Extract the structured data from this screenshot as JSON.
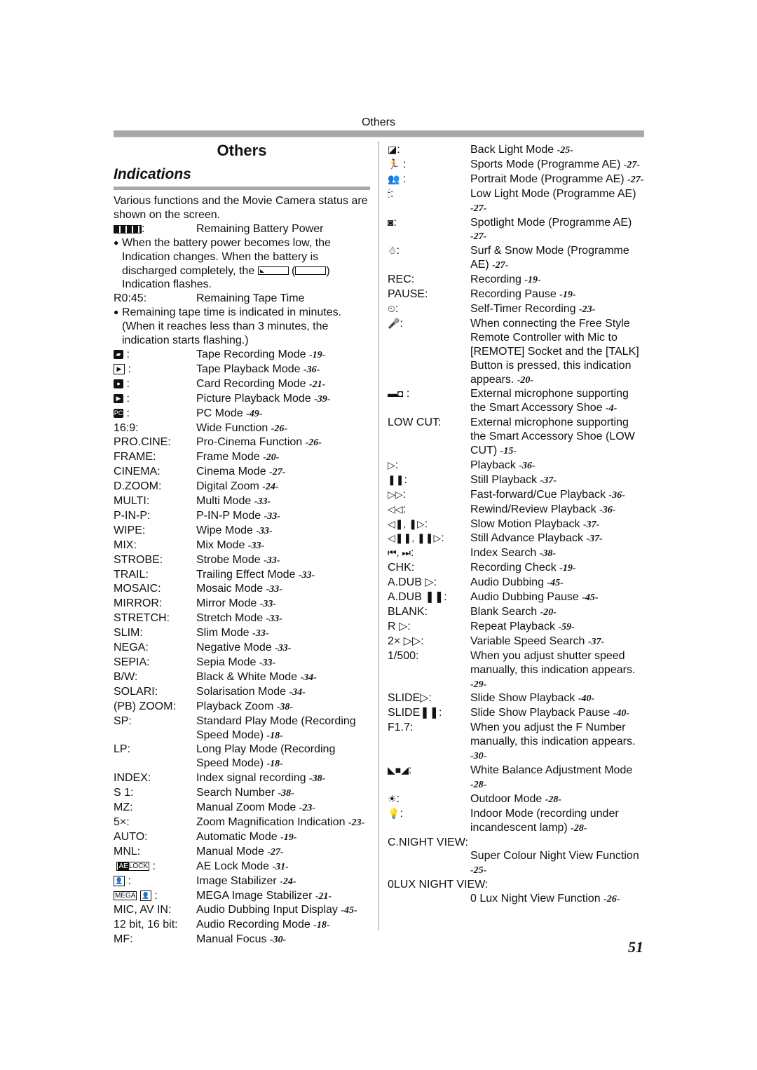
{
  "running_head": "Others",
  "title": "Others",
  "subtitle": "Indications",
  "intro": "Various functions and the Movie Camera status are shown on the screen.",
  "battery": {
    "key_suffix": ":",
    "label": "Remaining Battery Power",
    "note_a": "When the battery power becomes low, the Indication changes. When the battery is discharged completely, the",
    "note_b": "Indication flashes."
  },
  "tape": {
    "key": "R0:45:",
    "label": "Remaining Tape Time",
    "note": "Remaining tape time is indicated in minutes. (When it reaches less than 3 minutes, the indication starts flashing.)"
  },
  "left_icon_rows": [
    {
      "icon": "camera-tape-icon",
      "glyph": "▰",
      "label": "Tape Recording Mode",
      "ref": "-19-"
    },
    {
      "icon": "tape-playback-icon",
      "glyph": "▶",
      "label": "Tape Playback Mode",
      "ref": "-36-"
    },
    {
      "icon": "card-recording-icon",
      "glyph": "●",
      "label": "Card Recording Mode",
      "ref": "-21-"
    },
    {
      "icon": "picture-playback-icon",
      "glyph": "▶",
      "label": "Picture Playback Mode",
      "ref": "-39-"
    },
    {
      "icon": "pc-icon",
      "glyph": "PC",
      "label": "PC Mode",
      "ref": "-49-"
    }
  ],
  "left_rows": [
    {
      "k": "16:9:",
      "v": "Wide Function",
      "ref": "-26-"
    },
    {
      "k": "PRO.CINE:",
      "v": "Pro-Cinema Function",
      "ref": "-26-"
    },
    {
      "k": "FRAME:",
      "v": "Frame Mode",
      "ref": "-20-"
    },
    {
      "k": "CINEMA:",
      "v": "Cinema Mode",
      "ref": "-27-"
    },
    {
      "k": "D.ZOOM:",
      "v": "Digital Zoom",
      "ref": "-24-"
    },
    {
      "k": "MULTI:",
      "v": "Multi Mode",
      "ref": "-33-"
    },
    {
      "k": "P-IN-P:",
      "v": "P-IN-P Mode",
      "ref": "-33-"
    },
    {
      "k": "WIPE:",
      "v": "Wipe Mode",
      "ref": "-33-"
    },
    {
      "k": "MIX:",
      "v": "Mix Mode",
      "ref": "-33-"
    },
    {
      "k": "STROBE:",
      "v": "Strobe Mode",
      "ref": "-33-"
    },
    {
      "k": "TRAIL:",
      "v": "Trailing Effect Mode",
      "ref": "-33-"
    },
    {
      "k": "MOSAIC:",
      "v": "Mosaic Mode",
      "ref": "-33-"
    },
    {
      "k": "MIRROR:",
      "v": "Mirror Mode",
      "ref": "-33-"
    },
    {
      "k": "STRETCH:",
      "v": "Stretch Mode",
      "ref": "-33-"
    },
    {
      "k": "SLIM:",
      "v": "Slim Mode",
      "ref": "-33-"
    },
    {
      "k": "NEGA:",
      "v": "Negative Mode",
      "ref": "-33-"
    },
    {
      "k": "SEPIA:",
      "v": "Sepia Mode",
      "ref": "-33-"
    },
    {
      "k": "B/W:",
      "v": "Black & White Mode",
      "ref": "-34-"
    },
    {
      "k": "SOLARI:",
      "v": "Solarisation Mode",
      "ref": "-34-"
    },
    {
      "k": "(PB) ZOOM:",
      "v": "Playback Zoom",
      "ref": "-38-"
    },
    {
      "k": "SP:",
      "v": "Standard Play Mode (Recording Speed Mode)",
      "ref": "-18-"
    },
    {
      "k": "LP:",
      "v": "Long Play Mode (Recording Speed Mode)",
      "ref": "-18-"
    },
    {
      "k": "INDEX:",
      "v": "Index signal recording",
      "ref": "-38-"
    },
    {
      "k": "S 1:",
      "v": "Search Number",
      "ref": "-38-"
    },
    {
      "k": "MZ:",
      "v": "Manual Zoom Mode",
      "ref": "-23-"
    },
    {
      "k": "5×:",
      "v": "Zoom Magnification Indication",
      "ref": "-23-"
    },
    {
      "k": "AUTO:",
      "v": "Automatic Mode",
      "ref": "-19-"
    },
    {
      "k": "MNL:",
      "v": "Manual Mode",
      "ref": "-27-"
    }
  ],
  "left_rows_2": [
    {
      "icon": "ae-lock-icon",
      "k_a": "AE",
      "k_b": "LOCK",
      "v": "AE Lock Mode",
      "ref": "-31-"
    },
    {
      "icon": "image-stabilizer-icon",
      "v": "Image Stabilizer",
      "ref": "-24-"
    },
    {
      "icon": "mega-stabilizer-icon",
      "k_a": "MEGA",
      "v": "MEGA Image Stabilizer",
      "ref": "-21-"
    },
    {
      "k": "MIC, AV IN:",
      "v": "Audio Dubbing Input Display",
      "ref": "-45-"
    },
    {
      "k": "12 bit, 16 bit:",
      "v": "Audio Recording Mode",
      "ref": "-18-"
    },
    {
      "k": "MF:",
      "v": "Manual Focus",
      "ref": "-30-"
    }
  ],
  "right_rows": [
    {
      "icon": "back-light-icon",
      "glyph": "◪",
      "k": ":",
      "v": "Back Light Mode",
      "ref": "-25-"
    },
    {
      "icon": "sports-icon",
      "glyph": "🏃",
      "k": " :",
      "v": "Sports Mode (Programme AE)",
      "ref": "-27-"
    },
    {
      "icon": "portrait-icon",
      "glyph": "👥",
      "k": " :",
      "v": "Portrait Mode (Programme AE)",
      "ref": "-27-"
    },
    {
      "icon": "low-light-icon",
      "glyph": "🕯",
      "k": ":",
      "v": "Low Light Mode (Programme AE)",
      "ref": "-27-"
    },
    {
      "icon": "spotlight-icon",
      "glyph": "◙",
      "k": ":",
      "v": "Spotlight Mode (Programme AE)",
      "ref": "-27-"
    },
    {
      "icon": "surf-snow-icon",
      "glyph": "☃",
      "k": ":",
      "v": "Surf & Snow Mode (Programme AE)",
      "ref": "-27-"
    },
    {
      "k": "REC:",
      "v": "Recording",
      "ref": "-19-"
    },
    {
      "k": "PAUSE:",
      "v": "Recording Pause",
      "ref": "-19-"
    },
    {
      "icon": "self-timer-icon",
      "glyph": "⏲",
      "k": ":",
      "v": "Self-Timer Recording",
      "ref": "-23-"
    },
    {
      "icon": "talk-mic-icon",
      "glyph": "🎤",
      "k": ":",
      "v": "When connecting the Free Style Remote Controller with Mic to [REMOTE] Socket and the [TALK] Button is pressed, this indication appears.",
      "ref": "-20-"
    },
    {
      "icon": "external-mic-icon",
      "glyph": "▬◘",
      "k": " :",
      "v": "External microphone supporting the Smart Accessory Shoe",
      "ref": "-4-"
    },
    {
      "k": "LOW CUT:",
      "v": "External microphone supporting the Smart Accessory Shoe (LOW CUT)",
      "ref": "-15-"
    },
    {
      "icon": "play-icon",
      "glyph": "▷",
      "k": ":",
      "v": "Playback",
      "ref": "-36-"
    },
    {
      "icon": "pause-icon",
      "glyph": "❚❚",
      "k": ":",
      "v": "Still Playback",
      "ref": "-37-"
    },
    {
      "icon": "fast-forward-icon",
      "glyph": "▷▷",
      "k": ":",
      "v": "Fast-forward/Cue Playback",
      "ref": "-36-"
    },
    {
      "icon": "rewind-icon",
      "glyph": "◁◁",
      "k": ":",
      "v": "Rewind/Review Playback",
      "ref": "-36-"
    },
    {
      "icon": "slow-motion-icon",
      "glyph": "◁❚, ❚▷",
      "k": ":",
      "v": "Slow Motion Playback",
      "ref": "-37-"
    },
    {
      "icon": "still-advance-icon",
      "glyph": "◁❚❚, ❚❚▷",
      "k": ":",
      "v": "Still Advance Playback",
      "ref": "-37-"
    },
    {
      "icon": "index-search-icon",
      "glyph": "⏮, ⏭",
      "k": ":",
      "v": "Index Search",
      "ref": "-38-"
    },
    {
      "k": "CHK:",
      "v": "Recording Check",
      "ref": "-19-"
    },
    {
      "k": "A.DUB ▷:",
      "v": "Audio Dubbing",
      "ref": "-45-"
    },
    {
      "k": "A.DUB ❚❚:",
      "v": "Audio Dubbing Pause",
      "ref": "-45-"
    },
    {
      "k": "BLANK:",
      "v": "Blank Search",
      "ref": "-20-"
    },
    {
      "k": "R ▷:",
      "v": "Repeat Playback",
      "ref": "-59-"
    },
    {
      "k": "2× ▷▷:",
      "v": "Variable Speed Search",
      "ref": "-37-"
    },
    {
      "k": "1/500:",
      "v": "When you adjust shutter speed manually, this indication appears.",
      "ref": "-29-"
    },
    {
      "k": "SLIDE▷:",
      "v": "Slide Show Playback",
      "ref": "-40-"
    },
    {
      "k": "SLIDE❚❚:",
      "v": "Slide Show Playback Pause",
      "ref": "-40-"
    },
    {
      "k": "F1.7:",
      "v": "When you adjust the F Number manually, this indication appears.",
      "ref": "-30-"
    },
    {
      "icon": "white-balance-icon",
      "glyph": "◣■◢",
      "k": ":",
      "v": "White Balance Adjustment Mode",
      "ref": "-28-"
    },
    {
      "icon": "outdoor-sun-icon",
      "glyph": "☀",
      "k": ":",
      "v": "Outdoor Mode",
      "ref": "-28-"
    },
    {
      "icon": "indoor-lamp-icon",
      "glyph": "💡",
      "k": ":",
      "v": "Indoor Mode (recording under incandescent lamp)",
      "ref": "-28-"
    }
  ],
  "night_rows": [
    {
      "k": "C.NIGHT VIEW:",
      "v": "Super Colour Night View Function",
      "ref": "-25-"
    },
    {
      "k": "0LUX NIGHT VIEW:",
      "v": "0 Lux Night View Function",
      "ref": "-26-"
    }
  ],
  "page_number": "51"
}
